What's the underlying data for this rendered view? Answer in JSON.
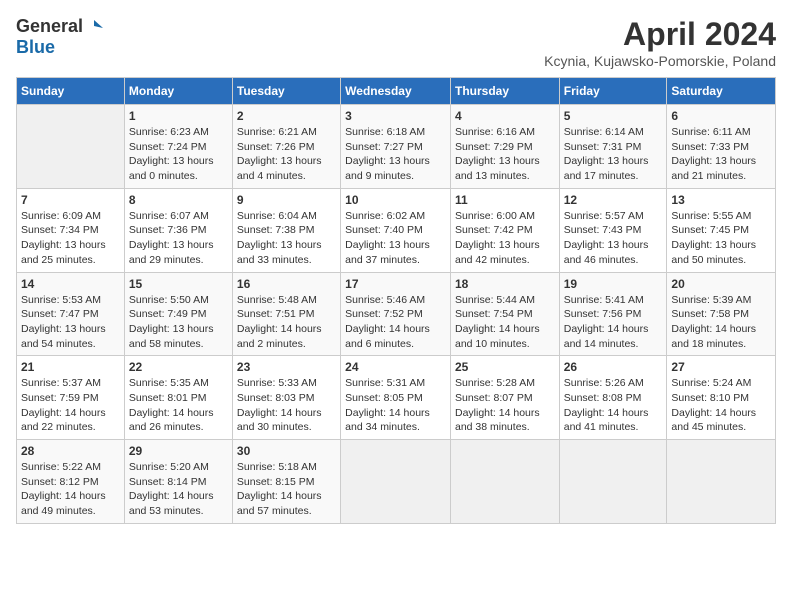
{
  "header": {
    "logo_general": "General",
    "logo_blue": "Blue",
    "month_title": "April 2024",
    "location": "Kcynia, Kujawsko-Pomorskie, Poland"
  },
  "days_of_week": [
    "Sunday",
    "Monday",
    "Tuesday",
    "Wednesday",
    "Thursday",
    "Friday",
    "Saturday"
  ],
  "weeks": [
    [
      {
        "day": "",
        "info": ""
      },
      {
        "day": "1",
        "info": "Sunrise: 6:23 AM\nSunset: 7:24 PM\nDaylight: 13 hours\nand 0 minutes."
      },
      {
        "day": "2",
        "info": "Sunrise: 6:21 AM\nSunset: 7:26 PM\nDaylight: 13 hours\nand 4 minutes."
      },
      {
        "day": "3",
        "info": "Sunrise: 6:18 AM\nSunset: 7:27 PM\nDaylight: 13 hours\nand 9 minutes."
      },
      {
        "day": "4",
        "info": "Sunrise: 6:16 AM\nSunset: 7:29 PM\nDaylight: 13 hours\nand 13 minutes."
      },
      {
        "day": "5",
        "info": "Sunrise: 6:14 AM\nSunset: 7:31 PM\nDaylight: 13 hours\nand 17 minutes."
      },
      {
        "day": "6",
        "info": "Sunrise: 6:11 AM\nSunset: 7:33 PM\nDaylight: 13 hours\nand 21 minutes."
      }
    ],
    [
      {
        "day": "7",
        "info": "Sunrise: 6:09 AM\nSunset: 7:34 PM\nDaylight: 13 hours\nand 25 minutes."
      },
      {
        "day": "8",
        "info": "Sunrise: 6:07 AM\nSunset: 7:36 PM\nDaylight: 13 hours\nand 29 minutes."
      },
      {
        "day": "9",
        "info": "Sunrise: 6:04 AM\nSunset: 7:38 PM\nDaylight: 13 hours\nand 33 minutes."
      },
      {
        "day": "10",
        "info": "Sunrise: 6:02 AM\nSunset: 7:40 PM\nDaylight: 13 hours\nand 37 minutes."
      },
      {
        "day": "11",
        "info": "Sunrise: 6:00 AM\nSunset: 7:42 PM\nDaylight: 13 hours\nand 42 minutes."
      },
      {
        "day": "12",
        "info": "Sunrise: 5:57 AM\nSunset: 7:43 PM\nDaylight: 13 hours\nand 46 minutes."
      },
      {
        "day": "13",
        "info": "Sunrise: 5:55 AM\nSunset: 7:45 PM\nDaylight: 13 hours\nand 50 minutes."
      }
    ],
    [
      {
        "day": "14",
        "info": "Sunrise: 5:53 AM\nSunset: 7:47 PM\nDaylight: 13 hours\nand 54 minutes."
      },
      {
        "day": "15",
        "info": "Sunrise: 5:50 AM\nSunset: 7:49 PM\nDaylight: 13 hours\nand 58 minutes."
      },
      {
        "day": "16",
        "info": "Sunrise: 5:48 AM\nSunset: 7:51 PM\nDaylight: 14 hours\nand 2 minutes."
      },
      {
        "day": "17",
        "info": "Sunrise: 5:46 AM\nSunset: 7:52 PM\nDaylight: 14 hours\nand 6 minutes."
      },
      {
        "day": "18",
        "info": "Sunrise: 5:44 AM\nSunset: 7:54 PM\nDaylight: 14 hours\nand 10 minutes."
      },
      {
        "day": "19",
        "info": "Sunrise: 5:41 AM\nSunset: 7:56 PM\nDaylight: 14 hours\nand 14 minutes."
      },
      {
        "day": "20",
        "info": "Sunrise: 5:39 AM\nSunset: 7:58 PM\nDaylight: 14 hours\nand 18 minutes."
      }
    ],
    [
      {
        "day": "21",
        "info": "Sunrise: 5:37 AM\nSunset: 7:59 PM\nDaylight: 14 hours\nand 22 minutes."
      },
      {
        "day": "22",
        "info": "Sunrise: 5:35 AM\nSunset: 8:01 PM\nDaylight: 14 hours\nand 26 minutes."
      },
      {
        "day": "23",
        "info": "Sunrise: 5:33 AM\nSunset: 8:03 PM\nDaylight: 14 hours\nand 30 minutes."
      },
      {
        "day": "24",
        "info": "Sunrise: 5:31 AM\nSunset: 8:05 PM\nDaylight: 14 hours\nand 34 minutes."
      },
      {
        "day": "25",
        "info": "Sunrise: 5:28 AM\nSunset: 8:07 PM\nDaylight: 14 hours\nand 38 minutes."
      },
      {
        "day": "26",
        "info": "Sunrise: 5:26 AM\nSunset: 8:08 PM\nDaylight: 14 hours\nand 41 minutes."
      },
      {
        "day": "27",
        "info": "Sunrise: 5:24 AM\nSunset: 8:10 PM\nDaylight: 14 hours\nand 45 minutes."
      }
    ],
    [
      {
        "day": "28",
        "info": "Sunrise: 5:22 AM\nSunset: 8:12 PM\nDaylight: 14 hours\nand 49 minutes."
      },
      {
        "day": "29",
        "info": "Sunrise: 5:20 AM\nSunset: 8:14 PM\nDaylight: 14 hours\nand 53 minutes."
      },
      {
        "day": "30",
        "info": "Sunrise: 5:18 AM\nSunset: 8:15 PM\nDaylight: 14 hours\nand 57 minutes."
      },
      {
        "day": "",
        "info": ""
      },
      {
        "day": "",
        "info": ""
      },
      {
        "day": "",
        "info": ""
      },
      {
        "day": "",
        "info": ""
      }
    ]
  ]
}
